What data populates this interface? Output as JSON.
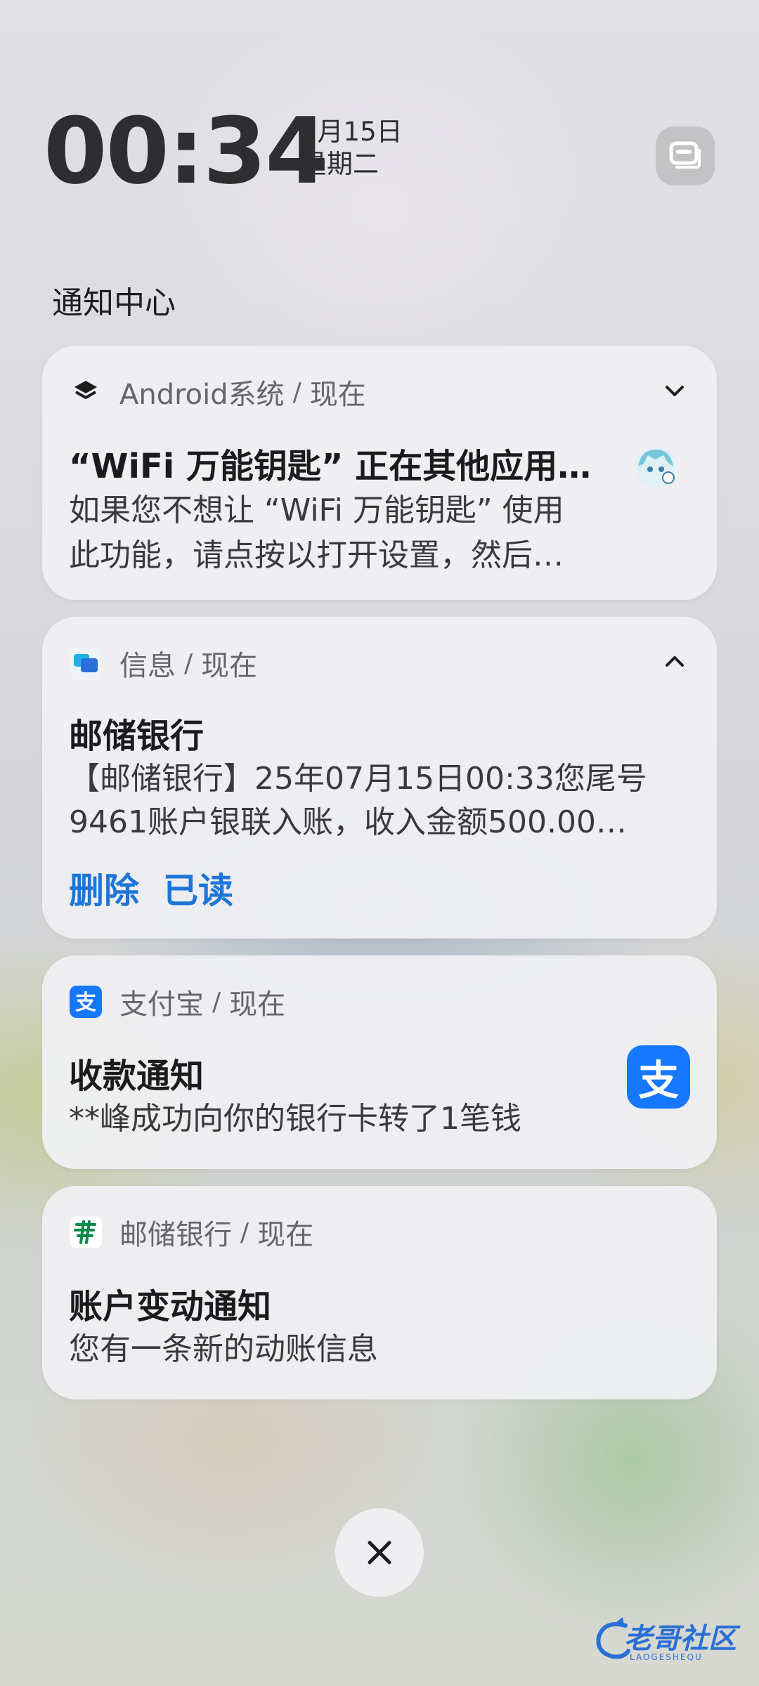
{
  "lockscreen": {
    "clock": "00:34",
    "date": "7月15日",
    "weekday": "星期二"
  },
  "notification_center": {
    "title": "通知中心"
  },
  "notifications": [
    {
      "app": "Android系统",
      "separator": "/",
      "time": "现在",
      "title": "“WiFi 万能钥匙” 正在其他应用…",
      "body_lines": [
        "如果您不想让 “WiFi 万能钥匙” 使用",
        "此功能，请点按以打开设置，然后…"
      ],
      "icon": "layers-icon",
      "expand_state": "collapsed"
    },
    {
      "app": "信息",
      "separator": "/",
      "time": "现在",
      "title": "邮储银行",
      "body_lines": [
        "【邮储银行】25年07月15日00:33您尾号",
        "9461账户银联入账，收入金额500.00…"
      ],
      "actions": [
        "删除",
        "已读"
      ],
      "icon": "messages-icon",
      "expand_state": "expanded"
    },
    {
      "app": "支付宝",
      "separator": "/",
      "time": "现在",
      "title": "收款通知",
      "body_lines": [
        "**峰成功向你的银行卡转了1笔钱"
      ],
      "icon": "alipay-icon",
      "large_icon_glyph": "支"
    },
    {
      "app": "邮储银行",
      "separator": "/",
      "time": "现在",
      "title": "账户变动通知",
      "body_lines": [
        "您有一条新的动账信息"
      ],
      "icon": "psbc-icon"
    }
  ],
  "watermark": {
    "text": "老哥社区",
    "subtext": "LAOGESHEQU"
  },
  "colors": {
    "accent_blue": "#1d75d8",
    "alipay_blue": "#1677ff",
    "psbc_green": "#0a8a4a"
  }
}
